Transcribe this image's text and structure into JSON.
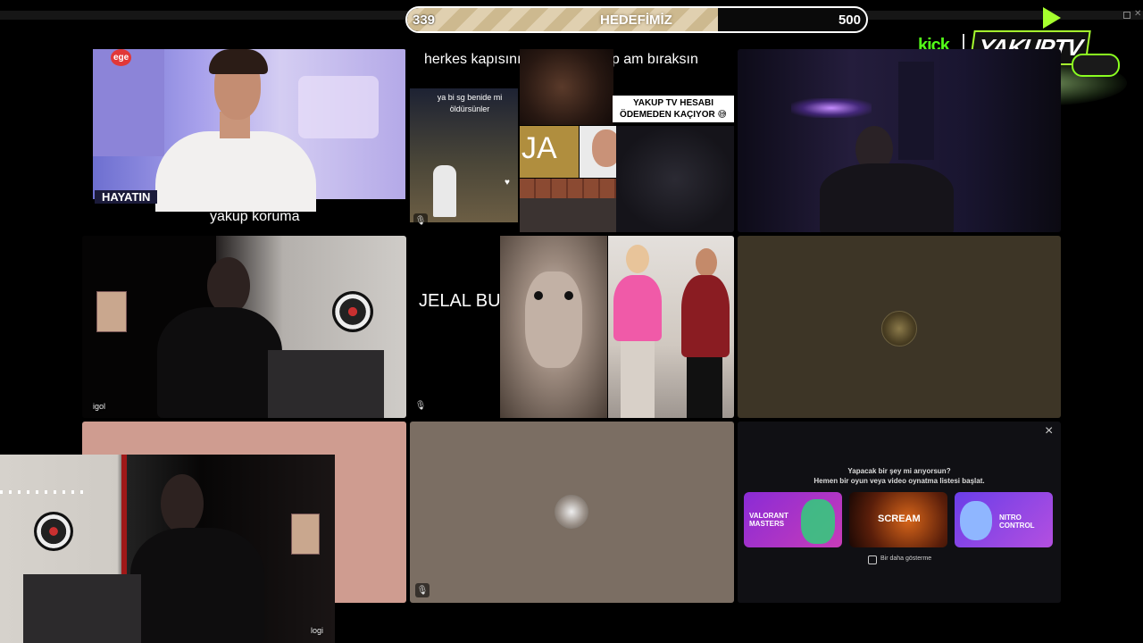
{
  "goal": {
    "current": "339",
    "title": "HEDEFİMİZ",
    "target": "500",
    "progress": 0.678
  },
  "brand": {
    "kick": "kick",
    "name": "YAKUPTV"
  },
  "tiles": {
    "tv": {
      "caption": "yakup koruma",
      "logo": "ege",
      "ticker": "HAYATIN"
    },
    "collage": {
      "caption": "herkes kapısının önüne bir kap am bıraksın",
      "left_text": "ya bi sg benide mi öldürsünler",
      "banner": "YAKUP TV HESABI ÖDEMEDEN KAÇIYOR 😅",
      "ja": "JA"
    },
    "jelal": {
      "caption": "JELAL BU"
    },
    "igol": {
      "name": "igol"
    },
    "logi": {
      "name": "logi"
    }
  },
  "activity_panel": {
    "title": "Yapacak bir şey mi arıyorsun?",
    "subtitle": "Hemen bir oyun veya video oynatma listesi başlat.",
    "checkbox_label": "Bir daha gösterme",
    "close": "×",
    "cards": [
      {
        "name": "VALORANT MASTERS",
        "color": "#8a2bd6"
      },
      {
        "name": "SCREAM",
        "color": "#d8661a"
      },
      {
        "name": "NITRO CONTROL",
        "color": "#6a3ee8"
      }
    ]
  },
  "colors": {
    "pink_tile": "#cf9c90",
    "olive_tile": "#3d3526",
    "taupe_tile": "#7b6e63",
    "panel_bg": "#101014"
  }
}
